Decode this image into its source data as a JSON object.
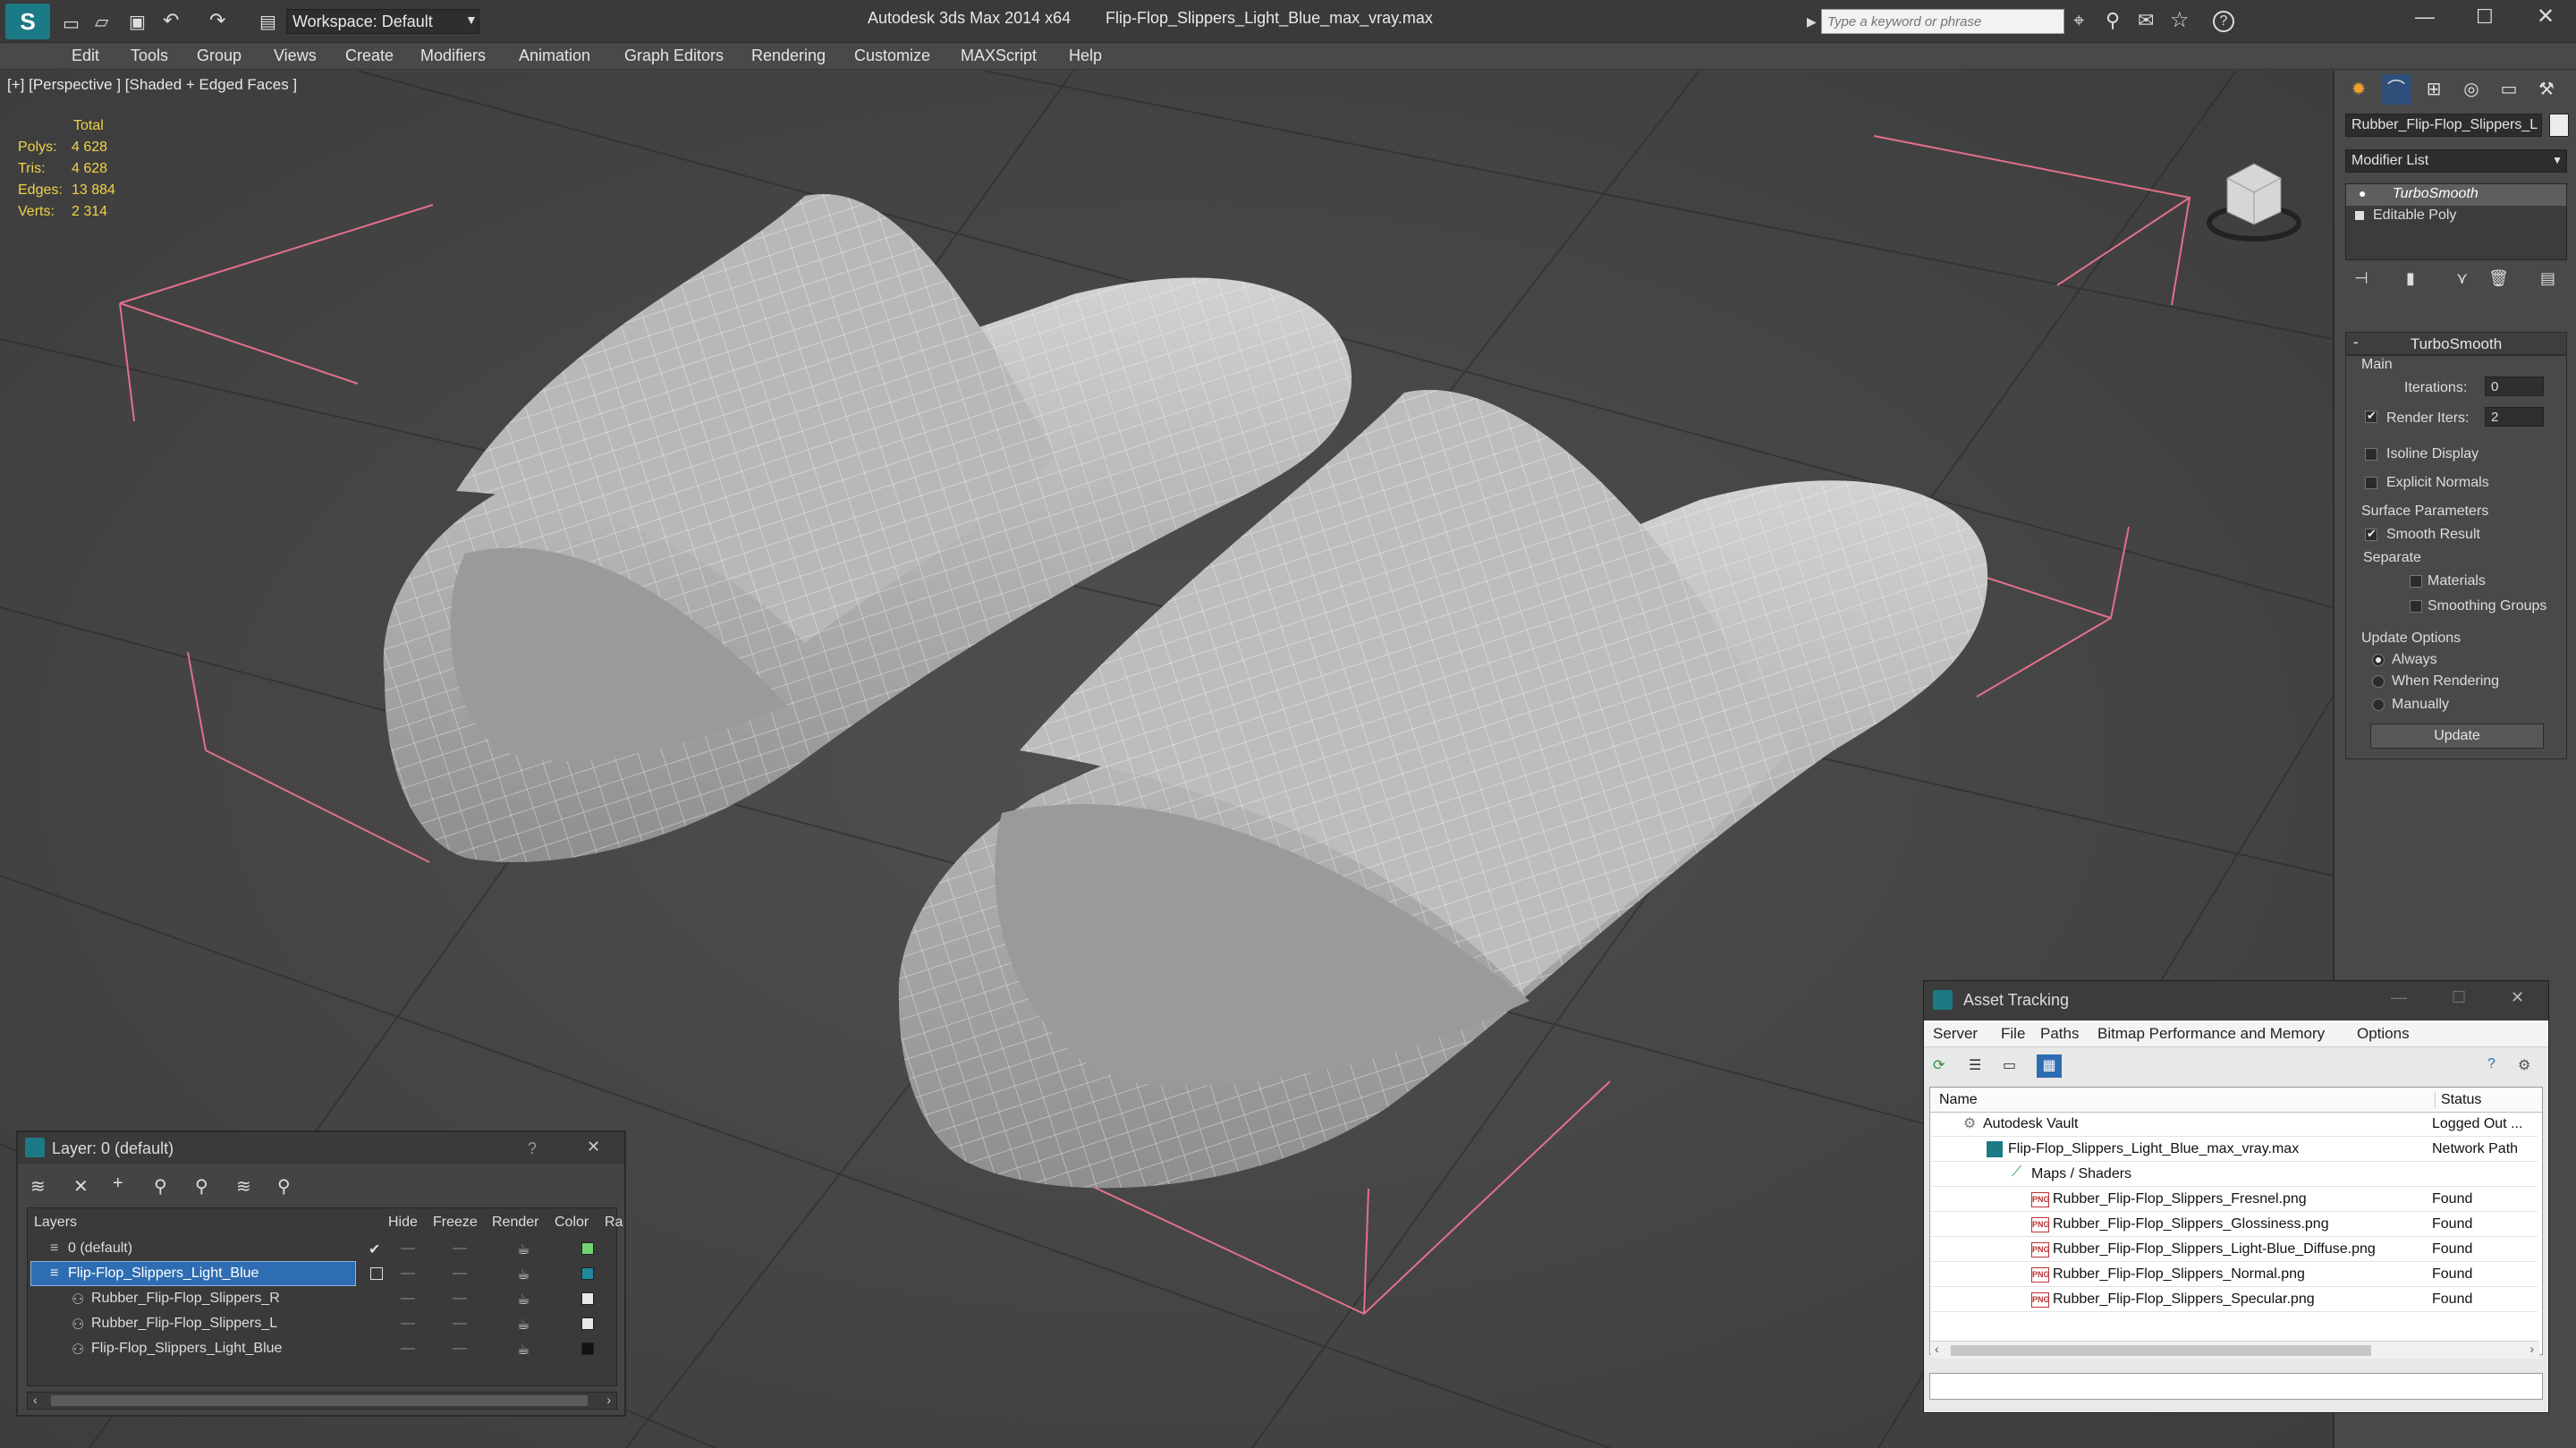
{
  "title_bar": {
    "workspace_label": "Workspace: Default",
    "app_title": "Autodesk 3ds Max  2014 x64",
    "file_title": "Flip-Flop_Slippers_Light_Blue_max_vray.max",
    "search_placeholder": "Type a keyword or phrase"
  },
  "menu": [
    "Edit",
    "Tools",
    "Group",
    "Views",
    "Create",
    "Modifiers",
    "Animation",
    "Graph Editors",
    "Rendering",
    "Customize",
    "MAXScript",
    "Help"
  ],
  "viewport": {
    "label": "[+] [Perspective ] [Shaded + Edged Faces ]",
    "stats": {
      "total_label": "Total",
      "polys_label": "Polys:",
      "polys": "4 628",
      "tris_label": "Tris:",
      "tris": "4 628",
      "edges_label": "Edges:",
      "edges": "13 884",
      "verts_label": "Verts:",
      "verts": "2 314"
    }
  },
  "command_panel": {
    "object_name": "Rubber_Flip-Flop_Slippers_L",
    "modifier_list": "Modifier List",
    "stack": [
      "TurboSmooth",
      "Editable Poly"
    ],
    "rollout_title": "TurboSmooth",
    "main_label": "Main",
    "iterations_label": "Iterations:",
    "iterations": "0",
    "render_iters_label": "Render Iters:",
    "render_iters": "2",
    "isoline_label": "Isoline Display",
    "explicit_label": "Explicit Normals",
    "surface_label": "Surface Parameters",
    "smooth_label": "Smooth Result",
    "separate_label": "Separate",
    "materials_label": "Materials",
    "smoothing_groups_label": "Smoothing Groups",
    "update_options_label": "Update Options",
    "always_label": "Always",
    "when_rendering_label": "When Rendering",
    "manually_label": "Manually",
    "update_button": "Update"
  },
  "layer_window": {
    "title": "Layer: 0 (default)",
    "help": "?",
    "columns": [
      "Layers",
      "Hide",
      "Freeze",
      "Render",
      "Color",
      "Ra"
    ],
    "rows": [
      {
        "name": "0 (default)",
        "color": "#6ed46e"
      },
      {
        "name": "Flip-Flop_Slippers_Light_Blue",
        "color": "#1f8a9a"
      },
      {
        "name": "Rubber_Flip-Flop_Slippers_R",
        "color": "#e8e8e8"
      },
      {
        "name": "Rubber_Flip-Flop_Slippers_L",
        "color": "#e8e8e8"
      },
      {
        "name": "Flip-Flop_Slippers_Light_Blue",
        "color": "#111111"
      }
    ]
  },
  "asset_tracking": {
    "title": "Asset Tracking",
    "menu": [
      "Server",
      "File",
      "Paths",
      "Bitmap Performance and Memory",
      "Options"
    ],
    "col_name": "Name",
    "col_status": "Status",
    "rows": [
      {
        "name": "Autodesk Vault",
        "status": "Logged Out ..."
      },
      {
        "name": "Flip-Flop_Slippers_Light_Blue_max_vray.max",
        "status": "Network Path"
      },
      {
        "name": "Maps / Shaders",
        "status": ""
      },
      {
        "name": "Rubber_Flip-Flop_Slippers_Fresnel.png",
        "status": "Found"
      },
      {
        "name": "Rubber_Flip-Flop_Slippers_Glossiness.png",
        "status": "Found"
      },
      {
        "name": "Rubber_Flip-Flop_Slippers_Light-Blue_Diffuse.png",
        "status": "Found"
      },
      {
        "name": "Rubber_Flip-Flop_Slippers_Normal.png",
        "status": "Found"
      },
      {
        "name": "Rubber_Flip-Flop_Slippers_Specular.png",
        "status": "Found"
      }
    ],
    "png_icon_text": "PNG"
  }
}
